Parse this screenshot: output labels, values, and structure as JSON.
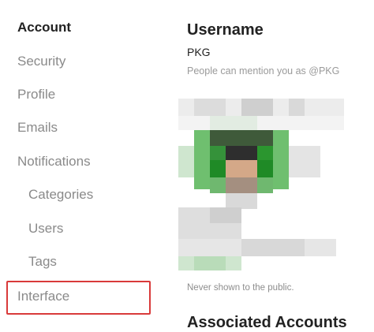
{
  "sidebar": {
    "items": [
      {
        "label": "Account"
      },
      {
        "label": "Security"
      },
      {
        "label": "Profile"
      },
      {
        "label": "Emails"
      },
      {
        "label": "Notifications"
      },
      {
        "label": "Categories"
      },
      {
        "label": "Users"
      },
      {
        "label": "Tags"
      },
      {
        "label": "Interface"
      }
    ]
  },
  "main": {
    "username": {
      "title": "Username",
      "value": "PKG",
      "help": "People can mention you as @PKG"
    },
    "email": {
      "help": "Never shown to the public."
    },
    "next_section": {
      "title": "Associated Accounts"
    }
  },
  "colors": {
    "highlight": "#d93a3a",
    "active_text": "#222222",
    "muted_text": "#8a8a8a"
  }
}
